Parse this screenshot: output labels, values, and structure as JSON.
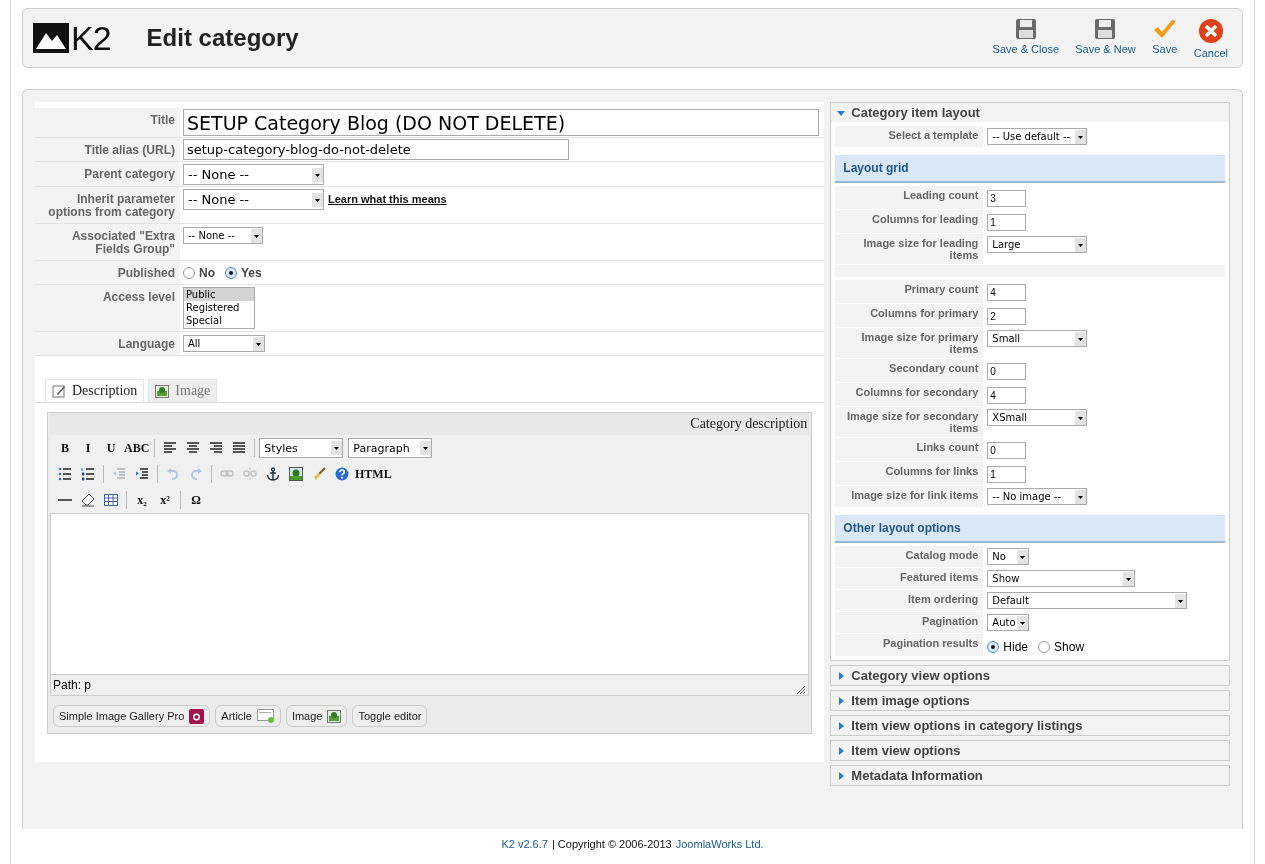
{
  "header": {
    "logo_text": "K2",
    "title": "Edit category",
    "toolbar": [
      {
        "kind": "disk",
        "label": "Save & Close"
      },
      {
        "kind": "disk",
        "label": "Save & New"
      },
      {
        "kind": "check",
        "label": "Save"
      },
      {
        "kind": "cancel",
        "label": "Cancel"
      }
    ]
  },
  "form": {
    "fields": [
      {
        "kind": "title",
        "label": "Title",
        "value": "SETUP Category Blog (DO NOT DELETE)"
      },
      {
        "kind": "text",
        "label": "Title alias (URL)",
        "value": "setup-category-blog-do-not-delete"
      },
      {
        "kind": "select",
        "label": "Parent category",
        "value": "-- None --"
      },
      {
        "kind": "select-link",
        "label": "Inherit parameter options from category",
        "value": "-- None --",
        "link": "Learn what this means"
      },
      {
        "kind": "select-small",
        "label": "Associated \"Extra Fields Group\"",
        "value": "-- None --"
      },
      {
        "kind": "radio",
        "label": "Published",
        "options": [
          {
            "label": "No",
            "selected": false
          },
          {
            "label": "Yes",
            "selected": true
          }
        ]
      },
      {
        "kind": "listbox",
        "label": "Access level",
        "options": [
          {
            "label": "Public",
            "selected": true
          },
          {
            "label": "Registered",
            "selected": false
          },
          {
            "label": "Special",
            "selected": false
          }
        ]
      },
      {
        "kind": "select-lang",
        "label": "Language",
        "value": "All"
      }
    ]
  },
  "editor": {
    "tabs": [
      {
        "kind": "pencil",
        "label": "Description",
        "selected": true
      },
      {
        "kind": "picture",
        "label": "Image",
        "selected": false
      }
    ],
    "heading": "Category description",
    "toolbar_rows": [
      [
        {
          "kind": "glyph",
          "text": "B",
          "disabled": false
        },
        {
          "kind": "glyph",
          "text": "I",
          "disabled": false
        },
        {
          "kind": "glyph",
          "text": "U",
          "disabled": false
        },
        {
          "kind": "glyph",
          "text": "ABC",
          "disabled": false
        },
        {
          "kind": "sep"
        },
        {
          "kind": "align-left",
          "disabled": false
        },
        {
          "kind": "align-center",
          "disabled": false
        },
        {
          "kind": "align-right",
          "disabled": false
        },
        {
          "kind": "align-justify",
          "disabled": false
        },
        {
          "kind": "sep"
        },
        {
          "kind": "select",
          "text": "Styles"
        },
        {
          "kind": "select",
          "text": "Paragraph"
        }
      ],
      [
        {
          "kind": "bullets",
          "disabled": false
        },
        {
          "kind": "numbers",
          "disabled": false
        },
        {
          "kind": "sep"
        },
        {
          "kind": "outdent",
          "disabled": true
        },
        {
          "kind": "indent",
          "disabled": false
        },
        {
          "kind": "sep"
        },
        {
          "kind": "undo",
          "disabled": true
        },
        {
          "kind": "redo",
          "disabled": true
        },
        {
          "kind": "sep"
        },
        {
          "kind": "link",
          "disabled": true
        },
        {
          "kind": "unlink",
          "disabled": true
        },
        {
          "kind": "anchor",
          "disabled": false
        },
        {
          "kind": "picture",
          "disabled": false
        },
        {
          "kind": "brush",
          "disabled": false
        },
        {
          "kind": "help",
          "disabled": false
        },
        {
          "kind": "glyph",
          "text": "HTML",
          "disabled": false
        }
      ],
      [
        {
          "kind": "rule",
          "disabled": false
        },
        {
          "kind": "eraser",
          "disabled": false
        },
        {
          "kind": "table",
          "disabled": false
        },
        {
          "kind": "sep"
        },
        {
          "kind": "glyph",
          "text": "x₂",
          "disabled": false
        },
        {
          "kind": "glyph",
          "text": "x²",
          "disabled": false
        },
        {
          "kind": "sep"
        },
        {
          "kind": "glyph",
          "text": "Ω",
          "disabled": false
        }
      ]
    ],
    "path": "Path: p",
    "buttons": [
      {
        "kind": "camera",
        "label": "Simple Image Gallery Pro"
      },
      {
        "kind": "article",
        "label": "Article"
      },
      {
        "kind": "picture",
        "label": "Image"
      },
      {
        "kind": "none",
        "label": "Toggle editor"
      }
    ]
  },
  "panel": {
    "sections": [
      {
        "title": "Category item layout",
        "expanded": true,
        "rows": [
          {
            "kind": "select",
            "label": "Select a template",
            "value": "-- Use default --"
          },
          {
            "kind": "heading",
            "label": "Layout grid"
          },
          {
            "kind": "text",
            "label": "Leading count",
            "value": "3"
          },
          {
            "kind": "text",
            "label": "Columns for leading",
            "value": "1"
          },
          {
            "kind": "select",
            "label": "Image size for leading items",
            "value": "Large"
          },
          {
            "kind": "spacer"
          },
          {
            "kind": "text",
            "label": "Primary count",
            "value": "4"
          },
          {
            "kind": "text",
            "label": "Columns for primary",
            "value": "2"
          },
          {
            "kind": "select",
            "label": "Image size for primary items",
            "value": "Small"
          },
          {
            "kind": "text",
            "label": "Secondary count",
            "value": "0"
          },
          {
            "kind": "text",
            "label": "Columns for secondary",
            "value": "4"
          },
          {
            "kind": "select",
            "label": "Image size for secondary items",
            "value": "XSmall"
          },
          {
            "kind": "text",
            "label": "Links count",
            "value": "0"
          },
          {
            "kind": "text",
            "label": "Columns for links",
            "value": "1"
          },
          {
            "kind": "select",
            "label": "Image size for link items",
            "value": "-- No image --"
          },
          {
            "kind": "heading",
            "label": "Other layout options"
          },
          {
            "kind": "select-narrow",
            "label": "Catalog mode",
            "value": "No"
          },
          {
            "kind": "select-wide",
            "label": "Featured items",
            "value": "Show"
          },
          {
            "kind": "select-wider",
            "label": "Item ordering",
            "value": "Default"
          },
          {
            "kind": "select-narrow",
            "label": "Pagination",
            "value": "Auto"
          },
          {
            "kind": "radio",
            "label": "Pagination results",
            "options": [
              {
                "label": "Hide",
                "selected": true
              },
              {
                "label": "Show",
                "selected": false
              }
            ]
          }
        ]
      },
      {
        "title": "Category view options",
        "expanded": false
      },
      {
        "title": "Item image options",
        "expanded": false
      },
      {
        "title": "Item view options in category listings",
        "expanded": false
      },
      {
        "title": "Item view options",
        "expanded": false
      },
      {
        "title": "Metadata Information",
        "expanded": false
      }
    ]
  },
  "footer": {
    "version": "K2 v2.6.7",
    "text": "| Copyright © 2006-2013",
    "link": "JoomlaWorks Ltd."
  }
}
